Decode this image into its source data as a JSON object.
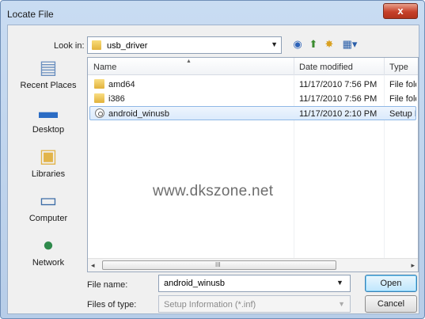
{
  "window": {
    "title": "Locate File",
    "close_label": "x"
  },
  "toolbar": {
    "look_in_label": "Look in:",
    "look_in_value": "usb_driver",
    "icons": [
      "back-icon",
      "up-folder-icon",
      "new-folder-icon",
      "views-menu-icon"
    ]
  },
  "places": [
    {
      "label": "Recent Places",
      "icon": "recent-places-icon"
    },
    {
      "label": "Desktop",
      "icon": "desktop-icon"
    },
    {
      "label": "Libraries",
      "icon": "libraries-icon"
    },
    {
      "label": "Computer",
      "icon": "computer-icon"
    },
    {
      "label": "Network",
      "icon": "network-icon"
    }
  ],
  "list": {
    "columns": [
      "Name",
      "Date modified",
      "Type"
    ],
    "rows": [
      {
        "name": "amd64",
        "date": "11/17/2010 7:56 PM",
        "type": "File folder",
        "icon": "folder-icon"
      },
      {
        "name": "i386",
        "date": "11/17/2010 7:56 PM",
        "type": "File folder",
        "icon": "folder-icon"
      },
      {
        "name": "android_winusb",
        "date": "11/17/2010 2:10 PM",
        "type": "Setup Infc",
        "icon": "setup-file-icon",
        "selected": true
      }
    ],
    "watermark": "www.dkszone.net",
    "scroll_grip": "III"
  },
  "footer": {
    "file_name_label": "File name:",
    "file_name_value": "android_winusb",
    "file_type_label": "Files of type:",
    "file_type_value": "Setup Information (*.inf)",
    "open_label": "Open",
    "cancel_label": "Cancel"
  },
  "colors": {
    "selection": "#dbeafc",
    "title_bar": "#c9dcf2",
    "close_button": "#c6412a"
  }
}
